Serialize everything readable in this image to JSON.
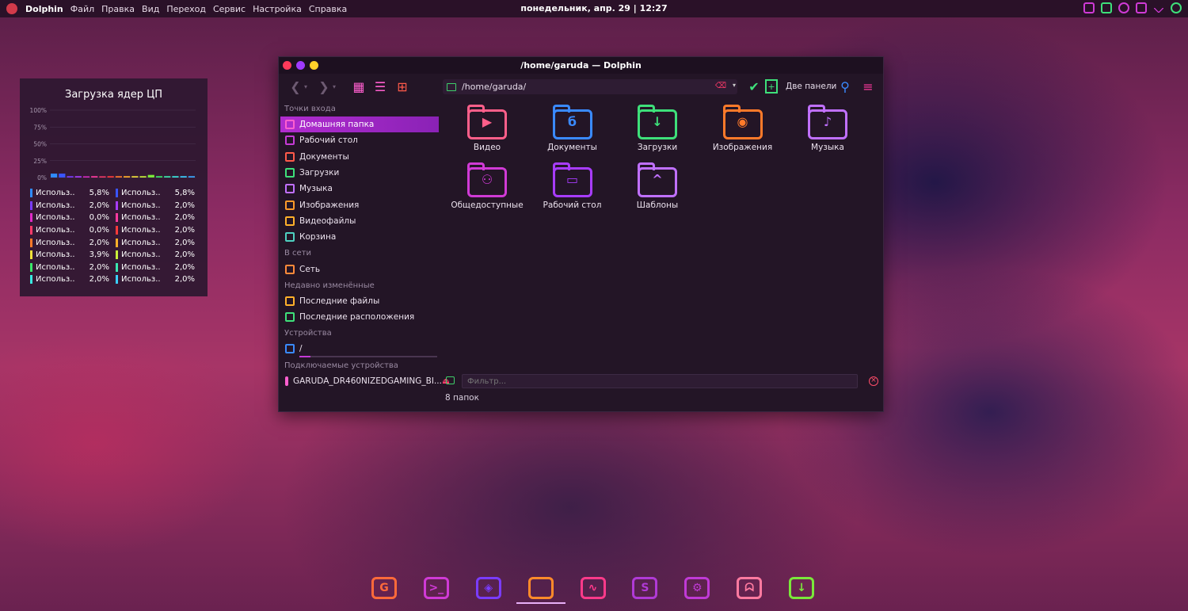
{
  "topbar": {
    "app_name": "Dolphin",
    "menu": [
      "Файл",
      "Правка",
      "Вид",
      "Переход",
      "Сервис",
      "Настройка",
      "Справка"
    ],
    "datetime": "понедельник, апр. 29 | 12:27",
    "tray_icons": [
      "clipboard-icon",
      "volume-icon",
      "network-icon",
      "notes-icon",
      "chevron-down-icon",
      "user-avatar-icon"
    ]
  },
  "cpu_widget": {
    "title": "Загрузка ядер ЦП",
    "chart_data": {
      "type": "bar",
      "y_ticks": [
        "100%",
        "75%",
        "50%",
        "25%",
        "0%"
      ],
      "ylim": [
        0,
        100
      ],
      "values": [
        5.8,
        5.8,
        2.0,
        2.0,
        0.0,
        2.0,
        0.0,
        2.0,
        2.0,
        2.0,
        2.0,
        2.0,
        3.9,
        2.0,
        2.0,
        2.0,
        2.0,
        2.0
      ],
      "colors": [
        "#2f8bff",
        "#3a55ff",
        "#7a3cff",
        "#a83cff",
        "#e02cc8",
        "#ff3aa0",
        "#ff3a6a",
        "#ff3a3a",
        "#ff7a2a",
        "#ffb02a",
        "#f0e03a",
        "#c8f03a",
        "#7ae83a",
        "#3ae86a",
        "#3ae8b0",
        "#3ae8e0",
        "#3ad0ff",
        "#3aa8ff"
      ]
    },
    "legend": [
      [
        {
          "label": "Использ...",
          "value": "5,8%",
          "color": "#2f8bff"
        },
        {
          "label": "Использ...",
          "value": "5,8%",
          "color": "#3a55ff"
        }
      ],
      [
        {
          "label": "Использ...",
          "value": "2,0%",
          "color": "#7a3cff"
        },
        {
          "label": "Использ...",
          "value": "2,0%",
          "color": "#a83cff"
        }
      ],
      [
        {
          "label": "Использ...",
          "value": "0,0%",
          "color": "#e02cc8"
        },
        {
          "label": "Использ...",
          "value": "2,0%",
          "color": "#ff3aa0"
        }
      ],
      [
        {
          "label": "Использ...",
          "value": "0,0%",
          "color": "#ff3a6a"
        },
        {
          "label": "Использ...",
          "value": "2,0%",
          "color": "#ff3a3a"
        }
      ],
      [
        {
          "label": "Использ...",
          "value": "2,0%",
          "color": "#ff7a2a"
        },
        {
          "label": "Использ...",
          "value": "2,0%",
          "color": "#ffb02a"
        }
      ],
      [
        {
          "label": "Использ...",
          "value": "3,9%",
          "color": "#f0e03a"
        },
        {
          "label": "Использ...",
          "value": "2,0%",
          "color": "#c8f03a"
        }
      ],
      [
        {
          "label": "Использ...",
          "value": "2,0%",
          "color": "#3ae86a"
        },
        {
          "label": "Использ...",
          "value": "2,0%",
          "color": "#3ae8b0"
        }
      ],
      [
        {
          "label": "Использ...",
          "value": "2,0%",
          "color": "#3ae8e0"
        },
        {
          "label": "Использ...",
          "value": "2,0%",
          "color": "#3ad0ff"
        }
      ]
    ]
  },
  "dolphin": {
    "title": "/home/garuda — Dolphin",
    "address": "/home/garuda/",
    "split_label": "Две панели",
    "places": {
      "entry_points_title": "Точки входа",
      "entry_points": [
        {
          "label": "Домашняя папка",
          "color": "#ff5fcf",
          "selected": true
        },
        {
          "label": "Рабочий стол",
          "color": "#c53ad6"
        },
        {
          "label": "Документы",
          "color": "#ff5a4a"
        },
        {
          "label": "Загрузки",
          "color": "#3ee07a"
        },
        {
          "label": "Музыка",
          "color": "#c070ff"
        },
        {
          "label": "Изображения",
          "color": "#ff9a2a"
        },
        {
          "label": "Видеофайлы",
          "color": "#ffb02a"
        },
        {
          "label": "Корзина",
          "color": "#4ed0c0"
        }
      ],
      "network_title": "В сети",
      "network": [
        {
          "label": "Сеть",
          "color": "#ff8a3a"
        }
      ],
      "recent_title": "Недавно изменённые",
      "recent": [
        {
          "label": "Последние файлы",
          "color": "#ffb02a"
        },
        {
          "label": "Последние расположения",
          "color": "#3ee07a"
        }
      ],
      "devices_title": "Устройства",
      "devices": [
        {
          "label": "/",
          "color": "#3a8aff"
        }
      ],
      "removable_title": "Подключаемые устройства",
      "removable": [
        {
          "label": "GARUDA_DR460NIZEDGAMING_BI...",
          "color": "#ff5fcf"
        }
      ]
    },
    "folders": [
      {
        "name": "Видео",
        "color": "#ff5f8a",
        "glyph": "▶"
      },
      {
        "name": "Документы",
        "color": "#3a8aff",
        "glyph": "б"
      },
      {
        "name": "Загрузки",
        "color": "#3ee07a",
        "glyph": "↓"
      },
      {
        "name": "Изображения",
        "color": "#ff7a2a",
        "glyph": "◉"
      },
      {
        "name": "Музыка",
        "color": "#c070ff",
        "glyph": "♪"
      },
      {
        "name": "Общедоступные",
        "color": "#d03ad6",
        "glyph": "⚇"
      },
      {
        "name": "Рабочий стол",
        "color": "#a83cff",
        "glyph": "▭"
      },
      {
        "name": "Шаблоны",
        "color": "#c070ff",
        "glyph": "^"
      }
    ],
    "filter_placeholder": "Фильтр...",
    "status": "8 папок"
  },
  "dock": [
    {
      "name": "garuda-assistant-icon",
      "color": "#ff6a3a",
      "glyph": "G"
    },
    {
      "name": "terminal-icon",
      "color": "#d03ad6",
      "glyph": ">_"
    },
    {
      "name": "browser-icon",
      "color": "#7a3cff",
      "glyph": "◈"
    },
    {
      "name": "file-manager-icon",
      "color": "#ff8a2a",
      "glyph": "",
      "active": true
    },
    {
      "name": "system-monitor-icon",
      "color": "#ff3a8a",
      "glyph": "∿"
    },
    {
      "name": "store-icon",
      "color": "#b03ad6",
      "glyph": "S"
    },
    {
      "name": "settings-icon",
      "color": "#c03ad6",
      "glyph": "⚙"
    },
    {
      "name": "ghost-icon",
      "color": "#ff7aa0",
      "glyph": "ᗣ"
    },
    {
      "name": "downloader-icon",
      "color": "#7ae83a",
      "glyph": "↓"
    }
  ]
}
